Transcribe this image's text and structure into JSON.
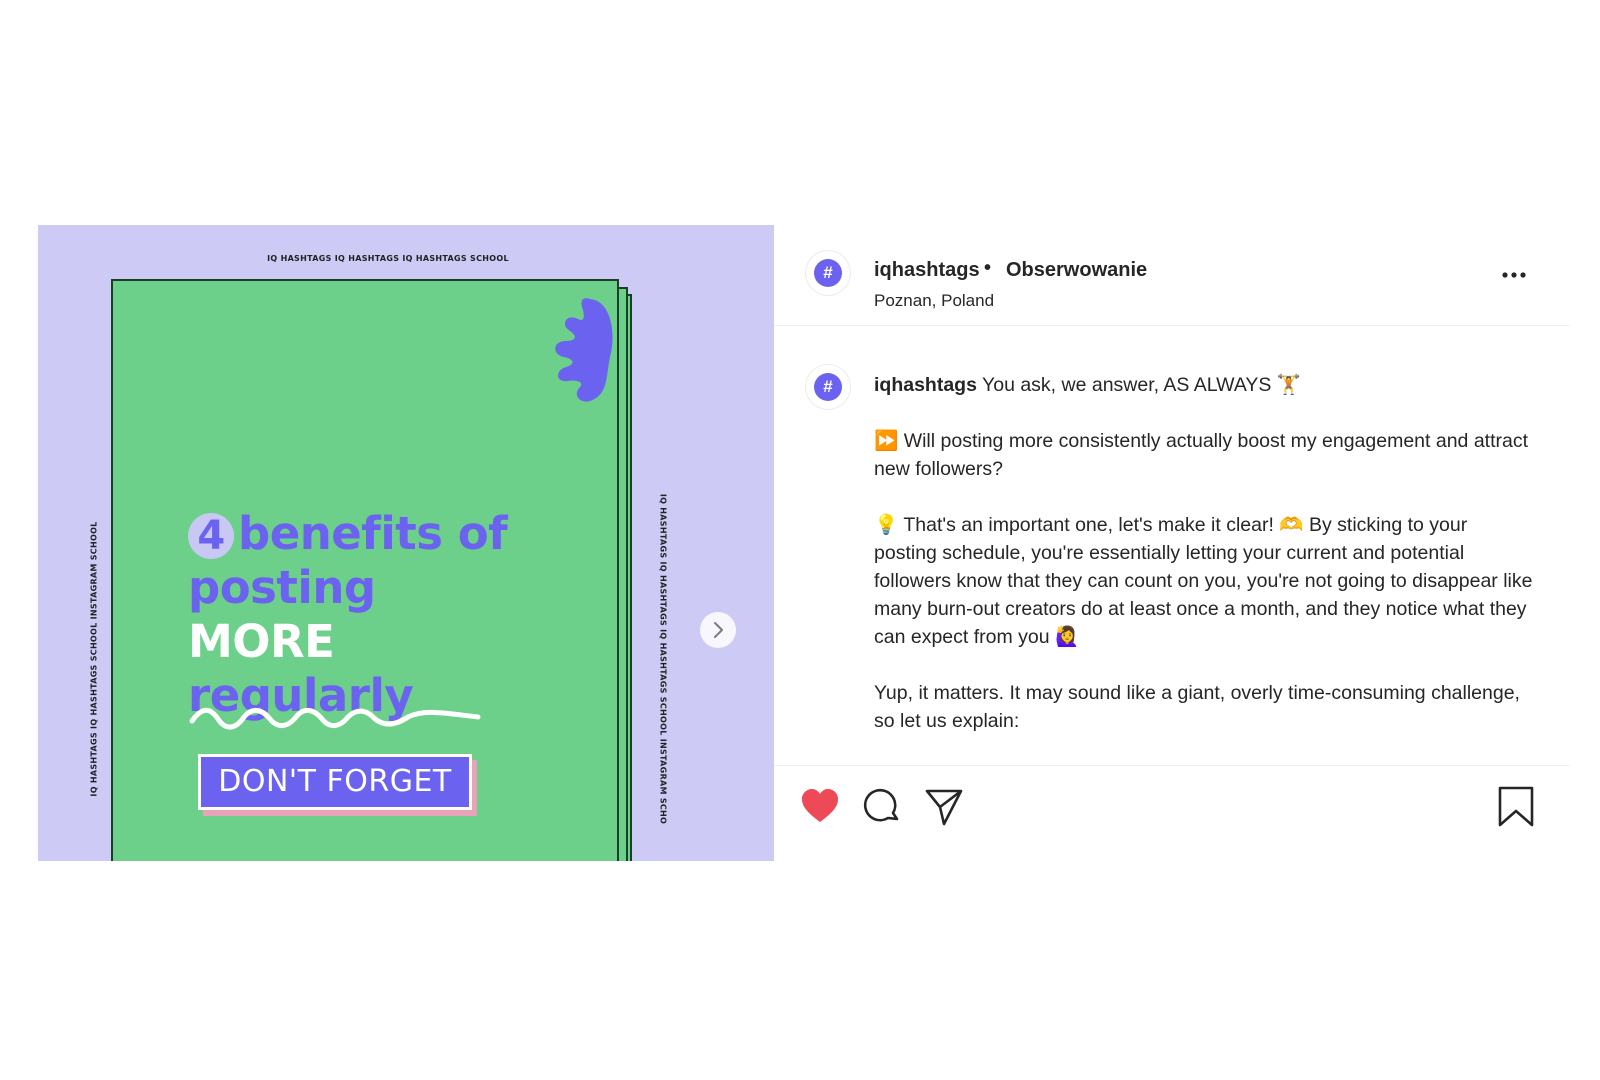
{
  "image": {
    "strip_top": "IQ HASHTAGS IQ HASHTAGS IQ HASHTAGS SCHOOL",
    "strip_left": "IQ HASHTAGS IQ HASHTAGS SCHOOL INSTAGRAM SCHOOL",
    "strip_right": "IQ HASHTAGS IQ HASHTAGS IQ HASHTAGS SCHOOL INSTAGRAM SCHO",
    "number": "4",
    "headline_1": "benefits of",
    "headline_2": "posting",
    "headline_3": "MORE",
    "headline_4": "regularly",
    "badge": "DON'T FORGET",
    "colors": {
      "background": "#cdcbf5",
      "sheet": "#6cd08a",
      "accent": "#6b63f0",
      "shadow": "#e8a3bb"
    }
  },
  "carousel": {
    "next_icon": "chevron-right-icon"
  },
  "header": {
    "avatar_glyph": "#",
    "username": "iqhashtags",
    "separator": "•",
    "follow_label": "Obserwowanie",
    "location": "Poznan, Poland",
    "more_icon": "more-options-icon"
  },
  "caption": {
    "username": "iqhashtags",
    "line_1": "You ask, we answer, AS ALWAYS 🏋",
    "paragraph_2": "⏩ Will posting more consistently actually boost my engagement and attract new followers?",
    "paragraph_3": "💡 That's an important one, let's make it clear! 🫶 By sticking to your posting schedule, you're essentially letting your current and potential followers know that they can count on you, you're not going to disappear like many burn-out creators do at least once a month, and they notice what they can expect from you 🙋‍♀",
    "paragraph_4": "Yup, it matters. It may sound like a giant, overly time-consuming challenge, so let us explain:",
    "paragraph_5": "✔"
  },
  "actions": {
    "like_icon": "heart-filled-icon",
    "like_color": "#ed4956",
    "comment_icon": "comment-icon",
    "share_icon": "share-icon",
    "save_icon": "bookmark-icon"
  }
}
